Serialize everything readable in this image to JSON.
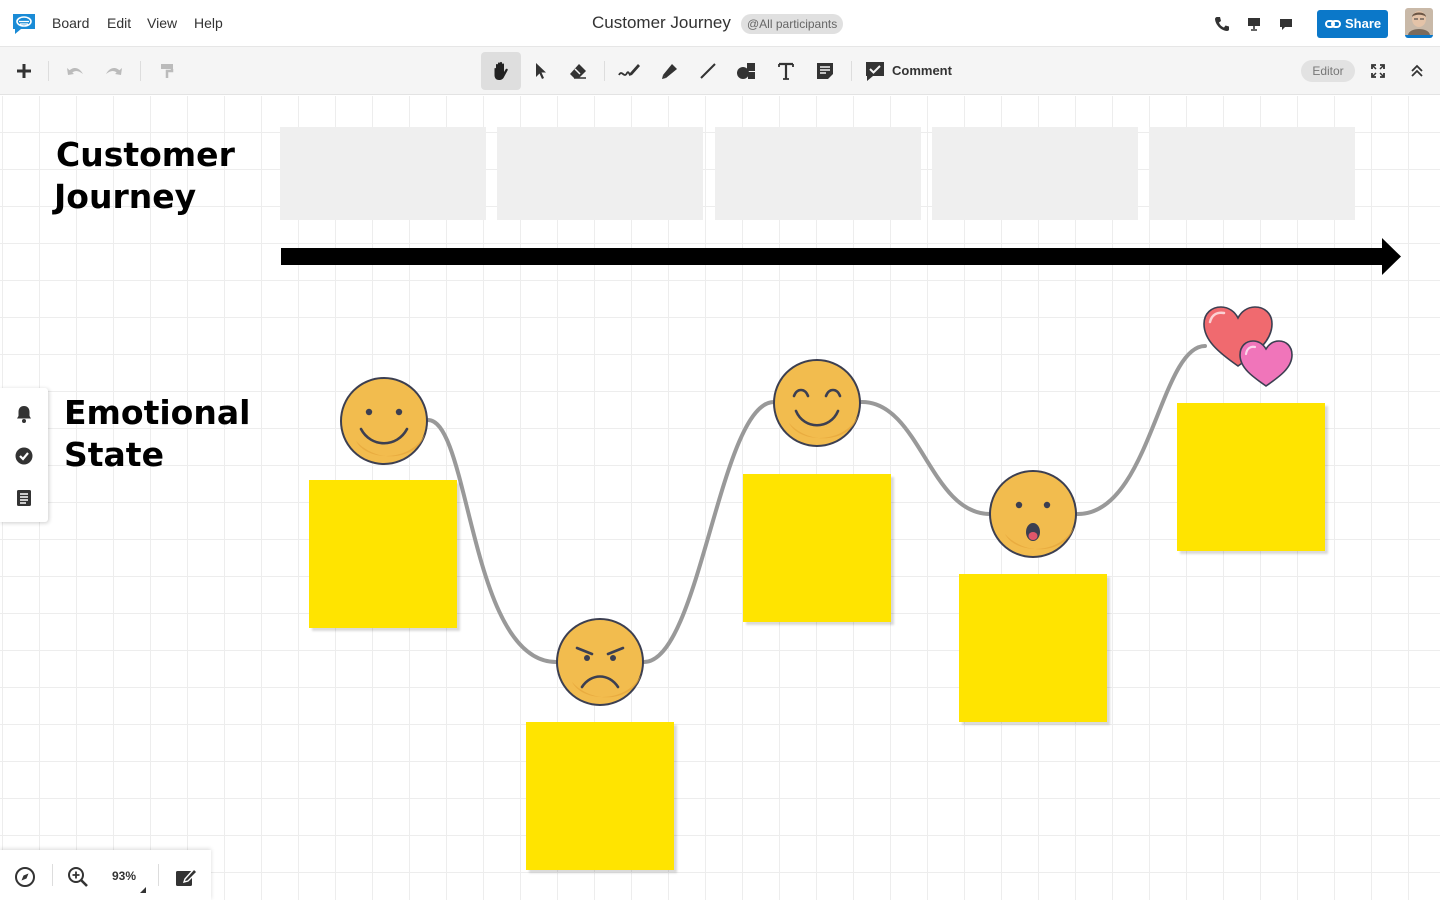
{
  "menubar": {
    "items": [
      {
        "label": "Board"
      },
      {
        "label": "Edit"
      },
      {
        "label": "View"
      },
      {
        "label": "Help"
      }
    ],
    "title": "Customer Journey",
    "participants": "@All participants",
    "share_label": "Share",
    "accent_color": "#0b78c9"
  },
  "toolbar": {
    "comment_label": "Comment",
    "role_badge": "Editor",
    "tools": [
      "add-icon",
      "undo-icon",
      "redo-icon",
      "format-painter-icon",
      "hand-icon",
      "select-icon",
      "eraser-icon",
      "pen-icon",
      "marker-icon",
      "line-icon",
      "shapes-icon",
      "text-icon",
      "sticky-note-icon",
      "comment-icon",
      "fullscreen-icon",
      "collapse-icon"
    ]
  },
  "board": {
    "heading_journey": [
      "Customer",
      "Journey"
    ],
    "heading_emotion": [
      "Emotional",
      "State"
    ],
    "stage_count": 5,
    "emotions": [
      "happy",
      "angry",
      "joyful",
      "surprised",
      "love"
    ],
    "sticky_color": "#ffe400"
  },
  "bottom": {
    "zoom": "93%"
  }
}
